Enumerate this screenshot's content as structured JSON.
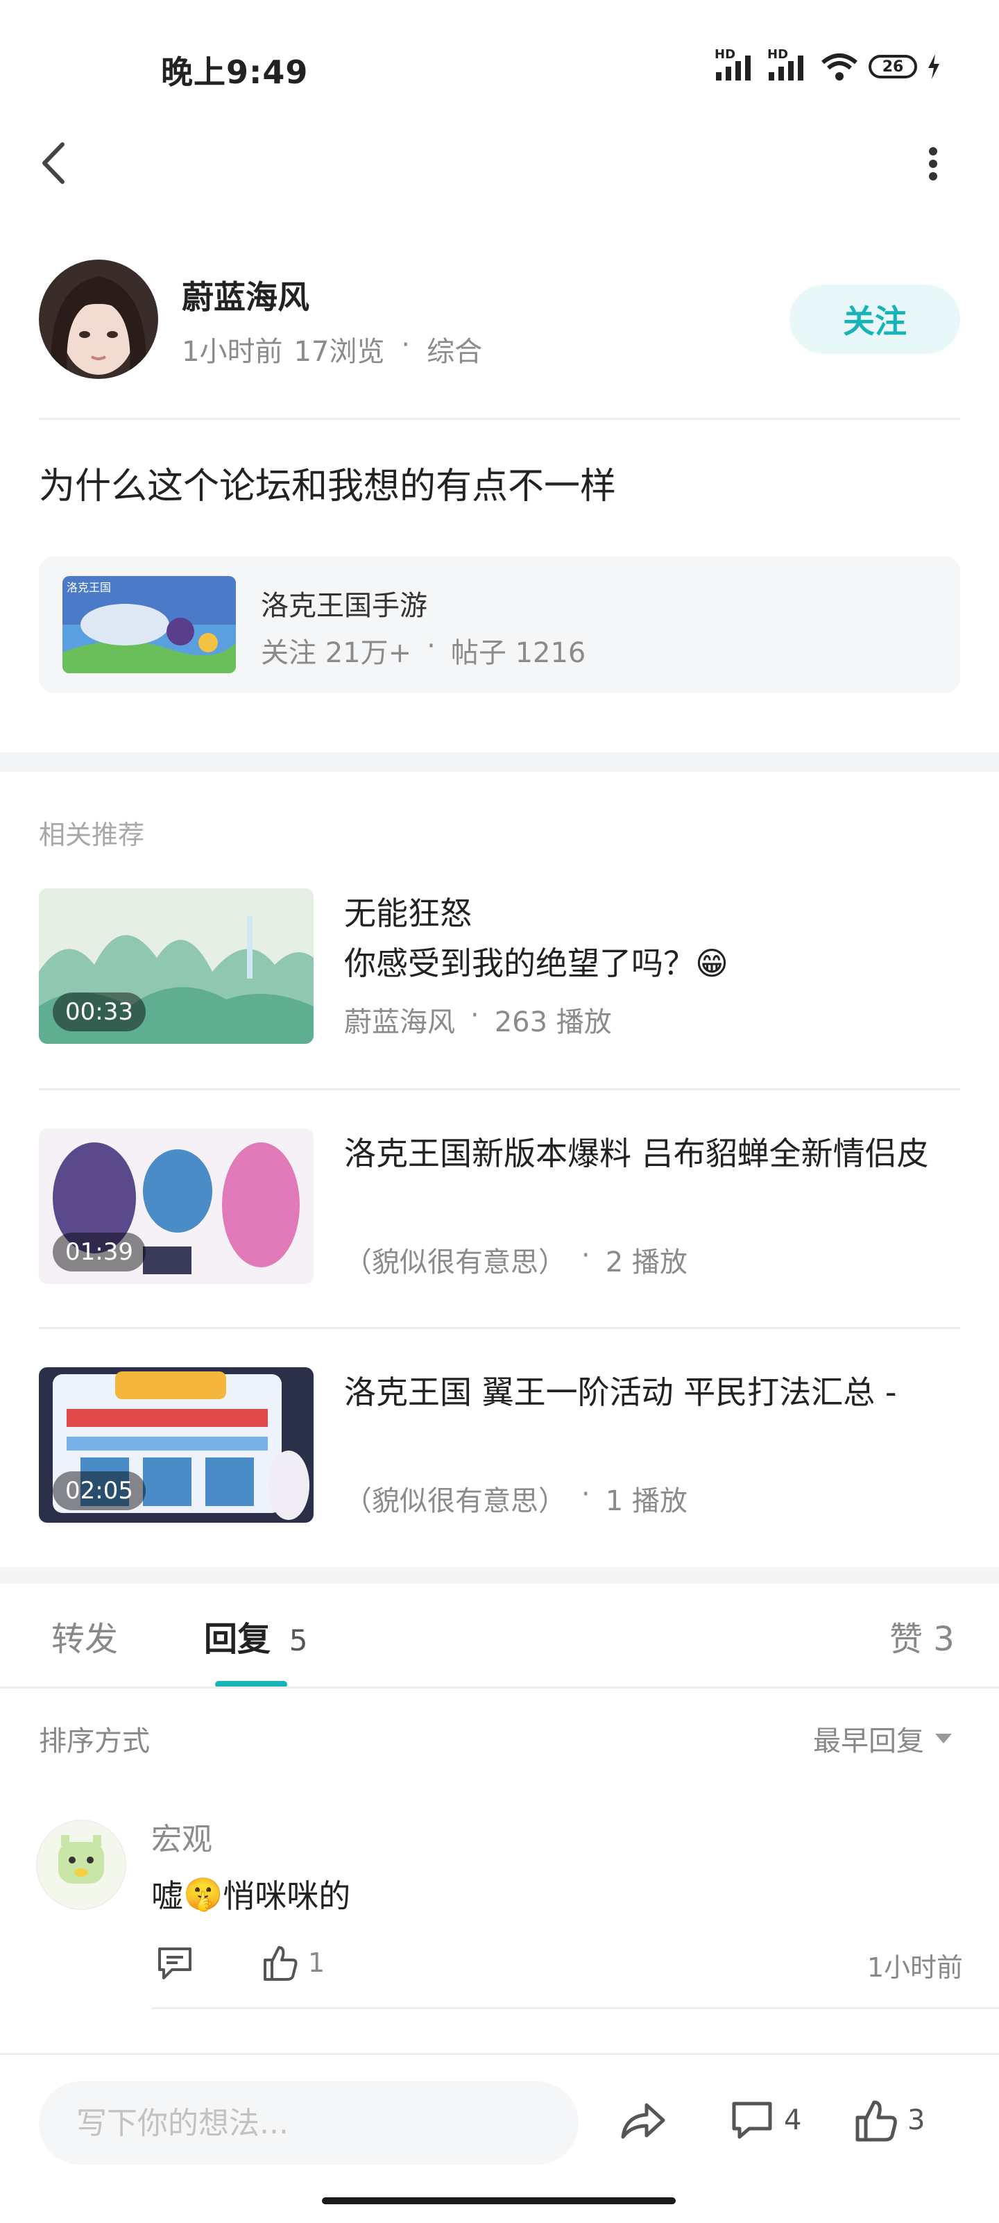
{
  "status_bar": {
    "time": "晚上9:49",
    "signal1_label": "HD",
    "signal2_label": "HD",
    "battery": "26"
  },
  "post": {
    "author": "蔚蓝海风",
    "time_ago": "1小时前",
    "views": "17浏览",
    "category": "综合",
    "follow_label": "关注",
    "title": "为什么这个论坛和我想的有点不一样"
  },
  "forum": {
    "name": "洛克王国手游",
    "followers": "关注 21万+",
    "posts": "帖子 1216",
    "thumb_tag": "洛克王国"
  },
  "related": {
    "heading": "相关推荐",
    "videos": [
      {
        "title": "无能狂怒\n你感受到我的绝望了吗？😁",
        "author": "蔚蓝海风",
        "plays": "263 播放",
        "duration": "00:33"
      },
      {
        "title": "洛克王国新版本爆料 吕布貂蝉全新情侣皮",
        "author": "（貌似很有意思）",
        "plays": "2 播放",
        "duration": "01:39"
      },
      {
        "title": "洛克王国 翼王一阶活动 平民打法汇总 -",
        "author": "（貌似很有意思）",
        "plays": "1 播放",
        "duration": "02:05"
      }
    ]
  },
  "tabs": {
    "forward": "转发",
    "reply": "回复",
    "reply_count": "5",
    "like": "赞 3"
  },
  "sort": {
    "label": "排序方式",
    "value": "最早回复"
  },
  "comment": {
    "user": "宏观",
    "text_before": "嘘",
    "emoji": "🤫",
    "text_after": "悄咪咪的",
    "likes": "1",
    "time": "1小时前"
  },
  "bottom_bar": {
    "placeholder": "写下你的想法...",
    "comments": "4",
    "likes": "3"
  },
  "colors": {
    "accent": "#17b3b8",
    "follow_bg": "#e8f8f8",
    "muted": "#8b8b8b"
  }
}
